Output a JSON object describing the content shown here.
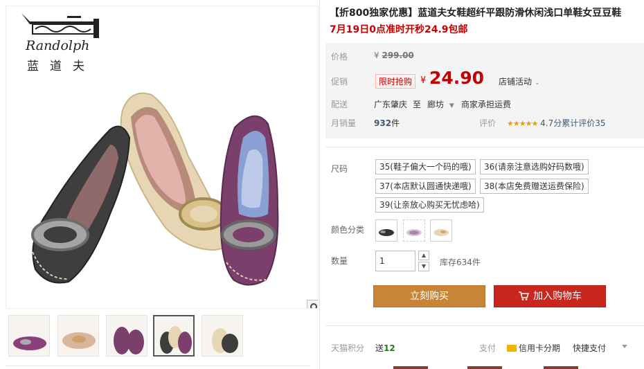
{
  "brand": {
    "name_en": "Randolph",
    "name_cn": "蓝道夫"
  },
  "product": {
    "title": "【折800独家优惠】蓝道夫女鞋超纤平跟防滑休闲浅口单鞋女豆豆鞋",
    "subtitle": "7月19日0点准时开秒24.9包邮"
  },
  "price": {
    "orig_label": "价格",
    "orig_symbol": "¥",
    "orig_value": "299.00",
    "promo_label": "促销",
    "promo_badge": "限时抢购",
    "cur_symbol": "¥",
    "cur_value": "24.90",
    "store_activity": "店铺活动"
  },
  "delivery": {
    "label": "配送",
    "from": "广东肇庆",
    "to_word": "至",
    "to": "廊坊",
    "note": "商家承担运费"
  },
  "sales": {
    "label": "月销量",
    "count": "932",
    "unit": "件",
    "rating_label": "评价",
    "rating_score": "4.7分",
    "rating_count": "累计评价35"
  },
  "sku": {
    "size_label": "尺码",
    "sizes": [
      "35(鞋子偏大一个码的哦)",
      "36(请亲注意选购好码数哦)",
      "37(本店默认圆通快递哦)",
      "38(本店免费赠送运费保险)",
      "39(让亲放心购买无忧虑哈)"
    ],
    "color_label": "颜色分类",
    "colors": [
      "black",
      "floral",
      "beige"
    ]
  },
  "quantity": {
    "label": "数量",
    "value": "1",
    "stock": "库存634件"
  },
  "actions": {
    "buy": "立刻购买",
    "cart": "加入购物车"
  },
  "footer": {
    "points_label": "天猫积分",
    "points_prefix": "送",
    "points_value": "12",
    "pay_label": "支付",
    "card_pay": "信用卡分期",
    "quick_pay": "快捷支付"
  },
  "colors": {
    "accent_red": "#c40000",
    "buy_orange": "#c88537",
    "cart_red": "#c8261e"
  }
}
